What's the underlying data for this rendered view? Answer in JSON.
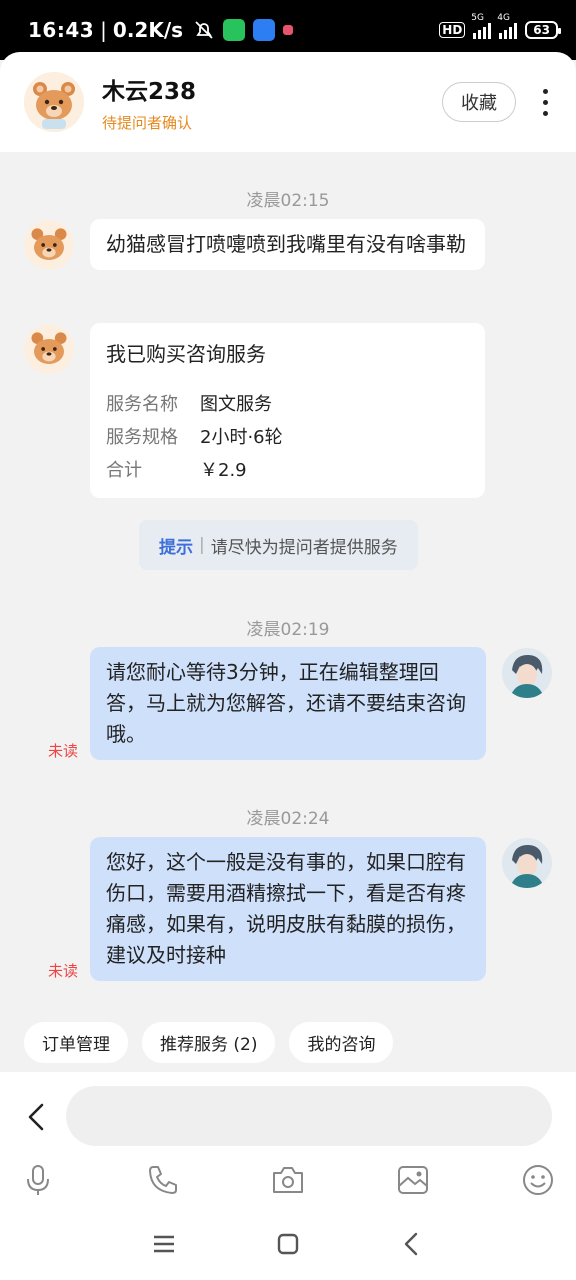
{
  "status": {
    "time": "16:43",
    "net_speed": "0.2K/s",
    "hd_label": "HD",
    "sig1_label": "5G",
    "sig2_label": "4G",
    "battery": "63"
  },
  "header": {
    "title": "木云238",
    "subtitle": "待提问者确认",
    "fav_label": "收藏"
  },
  "chat": {
    "messages": [
      {
        "time": "凌晨02:15",
        "side": "left",
        "text": "幼猫感冒打喷嚏喷到我嘴里有没有啥事勒"
      },
      {
        "side": "left",
        "service": {
          "title": "我已购买咨询服务",
          "rows": [
            {
              "key": "服务名称",
              "value": "图文服务"
            },
            {
              "key": "服务规格",
              "value": "2小时·6轮"
            },
            {
              "key": "合计",
              "value": "￥2.9"
            }
          ]
        }
      },
      {
        "tip": {
          "key": "提示",
          "text": "请尽快为提问者提供服务"
        }
      },
      {
        "time": "凌晨02:19",
        "side": "right",
        "status": "未读",
        "text": "请您耐心等待3分钟，正在编辑整理回答，马上就为您解答，还请不要结束咨询哦。"
      },
      {
        "time": "凌晨02:24",
        "side": "right",
        "status": "未读",
        "text": "您好，这个一般是没有事的，如果口腔有伤口，需要用酒精擦拭一下，看是否有疼痛感，如果有，说明皮肤有黏膜的损伤，建议及时接种"
      }
    ]
  },
  "chips": [
    {
      "label": "订单管理"
    },
    {
      "label": "推荐服务 (2)"
    },
    {
      "label": "我的咨询"
    }
  ],
  "input": {
    "placeholder": ""
  },
  "tools": [
    "microphone-icon",
    "phone-icon",
    "camera-icon",
    "image-icon",
    "emoji-icon"
  ],
  "colors": {
    "accent_orange": "#e58a1f",
    "bubble_right": "#cfe0fb",
    "tip_blue": "#3d6fd8",
    "unread_red": "#e44444"
  }
}
